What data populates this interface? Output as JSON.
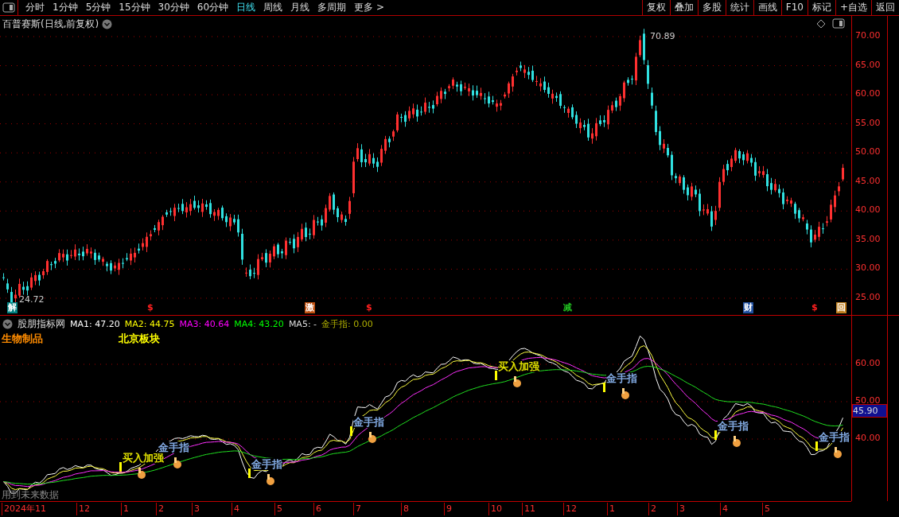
{
  "toolbar": {
    "periods": [
      {
        "label": "分时",
        "selected": false
      },
      {
        "label": "1分钟",
        "selected": false
      },
      {
        "label": "5分钟",
        "selected": false
      },
      {
        "label": "15分钟",
        "selected": false
      },
      {
        "label": "30分钟",
        "selected": false
      },
      {
        "label": "60分钟",
        "selected": false
      },
      {
        "label": "日线",
        "selected": true
      },
      {
        "label": "周线",
        "selected": false
      },
      {
        "label": "月线",
        "selected": false
      },
      {
        "label": "多周期",
        "selected": false
      },
      {
        "label": "更多 >",
        "selected": false
      }
    ],
    "buttons": [
      "复权",
      "叠加",
      "多股",
      "统计",
      "画线",
      "F10",
      "标记",
      "+自选",
      "返回"
    ]
  },
  "main_chart": {
    "title": "百普赛斯(日线,前复权)",
    "high_label": "70.89",
    "low_label": "24.72",
    "axis_labels": [
      "70.00",
      "65.00",
      "60.00",
      "55.00",
      "50.00",
      "45.00",
      "40.00",
      "35.00",
      "30.00",
      "25.00"
    ],
    "markers": [
      {
        "text": "解",
        "kind": "badge",
        "color": "#008080"
      },
      {
        "text": "$",
        "kind": "glyph",
        "color": "#ff2020"
      },
      {
        "text": "激",
        "kind": "badge",
        "color": "#c05010"
      },
      {
        "text": "$",
        "kind": "glyph",
        "color": "#ff2020"
      },
      {
        "text": "减",
        "kind": "glyph",
        "color": "#20c020"
      },
      {
        "text": "财",
        "kind": "badge",
        "color": "#2050a0"
      },
      {
        "text": "$",
        "kind": "glyph",
        "color": "#ff2020"
      },
      {
        "text": "回",
        "kind": "badge",
        "color": "#c08020"
      }
    ]
  },
  "indicator": {
    "name": "股朋指标网",
    "values": [
      {
        "text": "MA1: 47.20",
        "color": "#ffffff"
      },
      {
        "text": "MA2: 44.75",
        "color": "#ffff00"
      },
      {
        "text": "MA3: 40.64",
        "color": "#ff00ff"
      },
      {
        "text": "MA4: 43.20",
        "color": "#00ff00"
      },
      {
        "text": "MA5: -",
        "color": "#dddddd"
      },
      {
        "text": "金手指: 0.00",
        "color": "#b0b000"
      }
    ],
    "tags": [
      {
        "text": "生物制品",
        "color": "#ff8c00"
      },
      {
        "text": "北京板块",
        "color": "#ffff00"
      }
    ],
    "signals": [
      {
        "text": "买入加强",
        "color": "#e0e000"
      },
      {
        "text": "金手指",
        "color": "#80a8e0"
      },
      {
        "text": "金手指",
        "color": "#80a8e0"
      },
      {
        "text": "金手指",
        "color": "#80a8e0"
      },
      {
        "text": "买入加强",
        "color": "#e0e000"
      },
      {
        "text": "金手指",
        "color": "#80a8e0"
      },
      {
        "text": "金手指",
        "color": "#80a8e0"
      },
      {
        "text": "金手指",
        "color": "#80a8e0"
      }
    ],
    "axis_labels": [
      "60.00",
      "50.00",
      "40.00"
    ],
    "last_price": "45.90",
    "note": "用到未来数据"
  },
  "date_axis": [
    "2024年11",
    "12",
    "1",
    "2",
    "3",
    "4",
    "5",
    "6",
    "7",
    "8",
    "9",
    "10",
    "11",
    "12",
    "1",
    "2",
    "3",
    "4",
    "5"
  ]
}
